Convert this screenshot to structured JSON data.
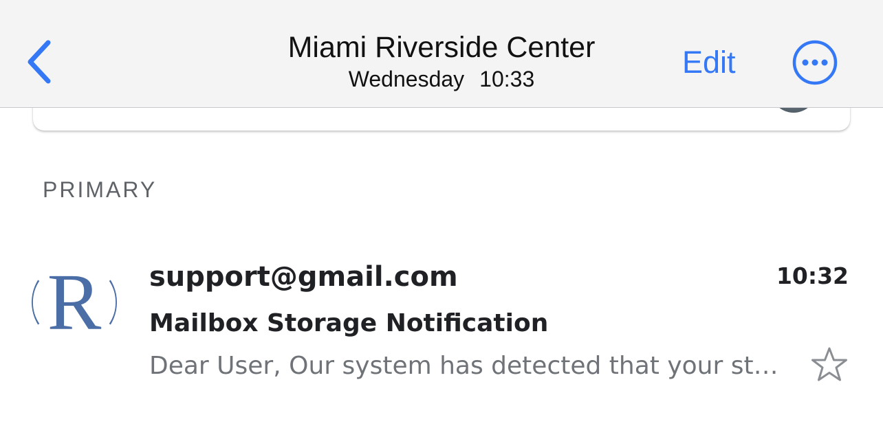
{
  "navbar": {
    "back_icon": "chevron-left-icon",
    "title": "Miami Riverside Center",
    "day": "Wednesday",
    "time": "10:33",
    "edit_label": "Edit",
    "more_icon": "ellipsis-circle-icon",
    "accent_color": "#3478f6"
  },
  "section": {
    "header": "PRIMARY"
  },
  "emails": [
    {
      "avatar_letter": "R",
      "avatar_color": "#4a6ea5",
      "sender": "support@gmail.com",
      "time": "10:32",
      "subject": "Mailbox Storage Notification",
      "snippet": "Dear User, Our system has detected that your storage",
      "starred": false,
      "star_icon": "star-outline-icon"
    }
  ]
}
